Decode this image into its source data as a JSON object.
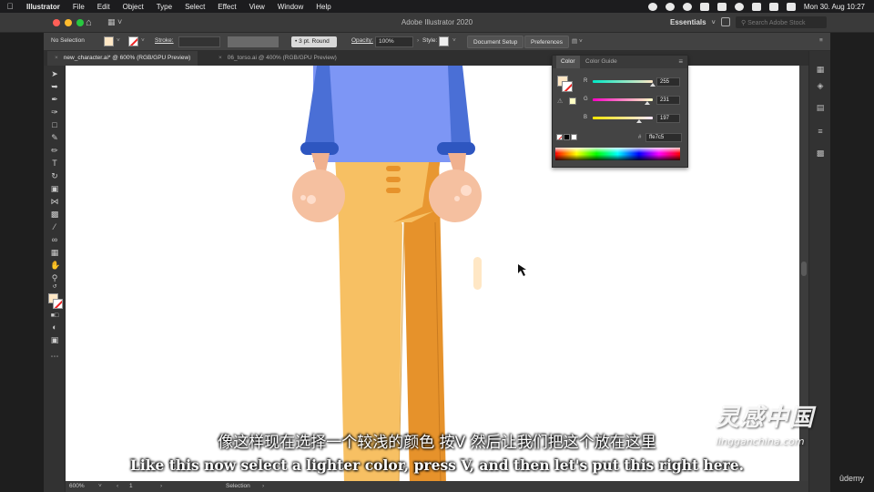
{
  "menubar": {
    "app": "Illustrator",
    "items": [
      "File",
      "Edit",
      "Object",
      "Type",
      "Select",
      "Effect",
      "View",
      "Window",
      "Help"
    ],
    "clock": "Mon 30. Aug  10:27"
  },
  "appbar": {
    "title": "Adobe Illustrator 2020",
    "workspace": "Essentials",
    "search_placeholder": "Search Adobe Stock"
  },
  "controlbar": {
    "selection": "No Selection",
    "stroke_label": "Stroke:",
    "brush": "3 pt. Round",
    "opacity_label": "Opacity:",
    "opacity_value": "100%",
    "style_label": "Style:",
    "document_setup": "Document Setup",
    "preferences": "Preferences"
  },
  "tabs": [
    {
      "label": "new_character.ai* @ 600% (RGB/GPU Preview)",
      "active": true
    },
    {
      "label": "06_torso.ai @ 400% (RGB/GPU Preview)",
      "active": false
    }
  ],
  "color_panel": {
    "tabs": [
      "Color",
      "Color Guide"
    ],
    "channels": [
      {
        "label": "R",
        "value": "255",
        "fraction": 1.0
      },
      {
        "label": "G",
        "value": "231",
        "fraction": 0.906
      },
      {
        "label": "B",
        "value": "197",
        "fraction": 0.773
      }
    ],
    "hex_label": "#",
    "hex": "ffe7c5",
    "fill_color": "#ffe7c5"
  },
  "statusbar": {
    "zoom": "600%",
    "artboard": "1",
    "tool": "Selection"
  },
  "subtitles": {
    "chinese": "像这样现在选择一个较浅的颜色 按V 然后让我们把这个放在这里",
    "english": "Like this now select a lighter color, press V, and then let's put this right here."
  },
  "watermark": {
    "brand": "灵感中国",
    "url": "lingganchina.com"
  },
  "udemy": "ûdemy",
  "colors": {
    "shirt": "#7d96f5",
    "sleeve": "#4a6fd6",
    "cuff": "#2e56c0",
    "pants_light": "#f7c063",
    "pants_dark": "#e6922b",
    "skin": "#f5c0a0",
    "fill_swatch": "#ffe7c5"
  }
}
